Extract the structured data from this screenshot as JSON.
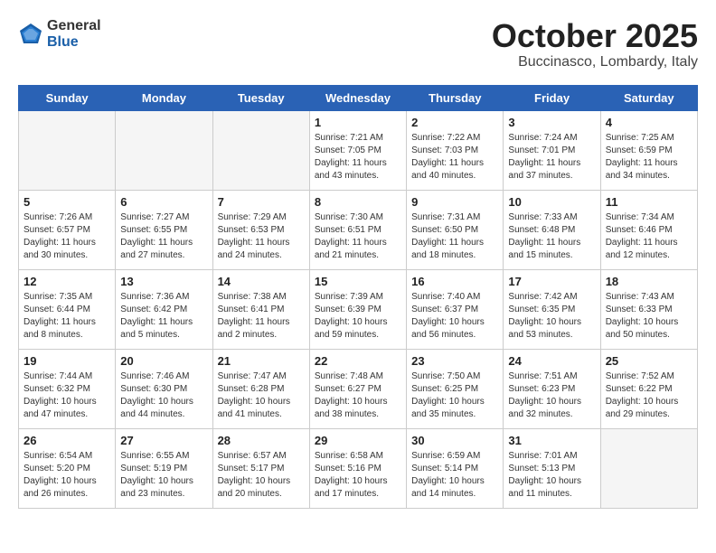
{
  "logo": {
    "general": "General",
    "blue": "Blue"
  },
  "header": {
    "month": "October 2025",
    "location": "Buccinasco, Lombardy, Italy"
  },
  "days_of_week": [
    "Sunday",
    "Monday",
    "Tuesday",
    "Wednesday",
    "Thursday",
    "Friday",
    "Saturday"
  ],
  "weeks": [
    [
      {
        "day": "",
        "info": ""
      },
      {
        "day": "",
        "info": ""
      },
      {
        "day": "",
        "info": ""
      },
      {
        "day": "1",
        "info": "Sunrise: 7:21 AM\nSunset: 7:05 PM\nDaylight: 11 hours\nand 43 minutes."
      },
      {
        "day": "2",
        "info": "Sunrise: 7:22 AM\nSunset: 7:03 PM\nDaylight: 11 hours\nand 40 minutes."
      },
      {
        "day": "3",
        "info": "Sunrise: 7:24 AM\nSunset: 7:01 PM\nDaylight: 11 hours\nand 37 minutes."
      },
      {
        "day": "4",
        "info": "Sunrise: 7:25 AM\nSunset: 6:59 PM\nDaylight: 11 hours\nand 34 minutes."
      }
    ],
    [
      {
        "day": "5",
        "info": "Sunrise: 7:26 AM\nSunset: 6:57 PM\nDaylight: 11 hours\nand 30 minutes."
      },
      {
        "day": "6",
        "info": "Sunrise: 7:27 AM\nSunset: 6:55 PM\nDaylight: 11 hours\nand 27 minutes."
      },
      {
        "day": "7",
        "info": "Sunrise: 7:29 AM\nSunset: 6:53 PM\nDaylight: 11 hours\nand 24 minutes."
      },
      {
        "day": "8",
        "info": "Sunrise: 7:30 AM\nSunset: 6:51 PM\nDaylight: 11 hours\nand 21 minutes."
      },
      {
        "day": "9",
        "info": "Sunrise: 7:31 AM\nSunset: 6:50 PM\nDaylight: 11 hours\nand 18 minutes."
      },
      {
        "day": "10",
        "info": "Sunrise: 7:33 AM\nSunset: 6:48 PM\nDaylight: 11 hours\nand 15 minutes."
      },
      {
        "day": "11",
        "info": "Sunrise: 7:34 AM\nSunset: 6:46 PM\nDaylight: 11 hours\nand 12 minutes."
      }
    ],
    [
      {
        "day": "12",
        "info": "Sunrise: 7:35 AM\nSunset: 6:44 PM\nDaylight: 11 hours\nand 8 minutes."
      },
      {
        "day": "13",
        "info": "Sunrise: 7:36 AM\nSunset: 6:42 PM\nDaylight: 11 hours\nand 5 minutes."
      },
      {
        "day": "14",
        "info": "Sunrise: 7:38 AM\nSunset: 6:41 PM\nDaylight: 11 hours\nand 2 minutes."
      },
      {
        "day": "15",
        "info": "Sunrise: 7:39 AM\nSunset: 6:39 PM\nDaylight: 10 hours\nand 59 minutes."
      },
      {
        "day": "16",
        "info": "Sunrise: 7:40 AM\nSunset: 6:37 PM\nDaylight: 10 hours\nand 56 minutes."
      },
      {
        "day": "17",
        "info": "Sunrise: 7:42 AM\nSunset: 6:35 PM\nDaylight: 10 hours\nand 53 minutes."
      },
      {
        "day": "18",
        "info": "Sunrise: 7:43 AM\nSunset: 6:33 PM\nDaylight: 10 hours\nand 50 minutes."
      }
    ],
    [
      {
        "day": "19",
        "info": "Sunrise: 7:44 AM\nSunset: 6:32 PM\nDaylight: 10 hours\nand 47 minutes."
      },
      {
        "day": "20",
        "info": "Sunrise: 7:46 AM\nSunset: 6:30 PM\nDaylight: 10 hours\nand 44 minutes."
      },
      {
        "day": "21",
        "info": "Sunrise: 7:47 AM\nSunset: 6:28 PM\nDaylight: 10 hours\nand 41 minutes."
      },
      {
        "day": "22",
        "info": "Sunrise: 7:48 AM\nSunset: 6:27 PM\nDaylight: 10 hours\nand 38 minutes."
      },
      {
        "day": "23",
        "info": "Sunrise: 7:50 AM\nSunset: 6:25 PM\nDaylight: 10 hours\nand 35 minutes."
      },
      {
        "day": "24",
        "info": "Sunrise: 7:51 AM\nSunset: 6:23 PM\nDaylight: 10 hours\nand 32 minutes."
      },
      {
        "day": "25",
        "info": "Sunrise: 7:52 AM\nSunset: 6:22 PM\nDaylight: 10 hours\nand 29 minutes."
      }
    ],
    [
      {
        "day": "26",
        "info": "Sunrise: 6:54 AM\nSunset: 5:20 PM\nDaylight: 10 hours\nand 26 minutes."
      },
      {
        "day": "27",
        "info": "Sunrise: 6:55 AM\nSunset: 5:19 PM\nDaylight: 10 hours\nand 23 minutes."
      },
      {
        "day": "28",
        "info": "Sunrise: 6:57 AM\nSunset: 5:17 PM\nDaylight: 10 hours\nand 20 minutes."
      },
      {
        "day": "29",
        "info": "Sunrise: 6:58 AM\nSunset: 5:16 PM\nDaylight: 10 hours\nand 17 minutes."
      },
      {
        "day": "30",
        "info": "Sunrise: 6:59 AM\nSunset: 5:14 PM\nDaylight: 10 hours\nand 14 minutes."
      },
      {
        "day": "31",
        "info": "Sunrise: 7:01 AM\nSunset: 5:13 PM\nDaylight: 10 hours\nand 11 minutes."
      },
      {
        "day": "",
        "info": ""
      }
    ]
  ]
}
